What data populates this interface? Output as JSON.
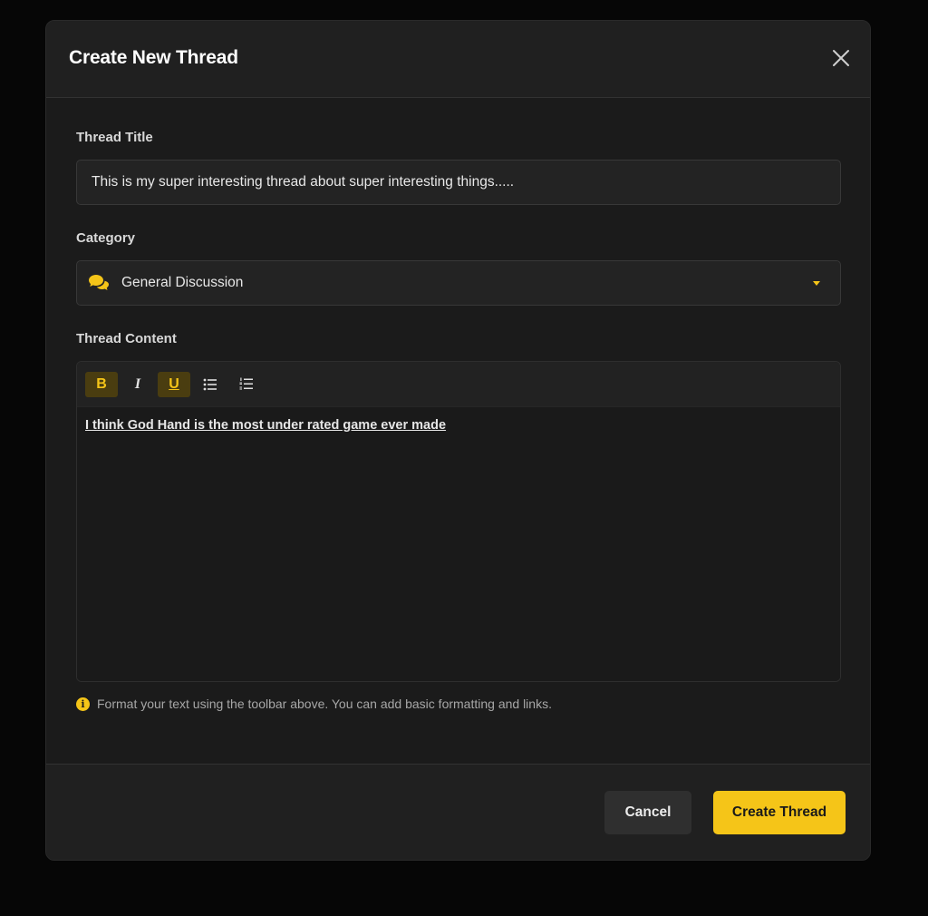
{
  "modal": {
    "title": "Create New Thread"
  },
  "form": {
    "title_label": "Thread Title",
    "title_value": "This is my super interesting thread about super interesting things.....",
    "category_label": "Category",
    "category_value": "General Discussion",
    "category_icon": "comments-icon",
    "content_label": "Thread Content",
    "content_value": "I think God Hand is the most under rated game ever made",
    "toolbar": {
      "bold": {
        "label": "B",
        "active": true
      },
      "italic": {
        "label": "I",
        "active": false
      },
      "underline": {
        "label": "U",
        "active": true
      },
      "bullet_list_icon": "bullet-list-icon",
      "numbered_list_icon": "numbered-list-icon"
    },
    "hint": "Format your text using the toolbar above. You can add basic formatting and links.",
    "hint_icon": "i"
  },
  "footer": {
    "cancel_label": "Cancel",
    "submit_label": "Create Thread"
  },
  "colors": {
    "accent": "#f5c518",
    "background": "#1b1b1b",
    "active_tool_bg": "#4a3d10"
  }
}
